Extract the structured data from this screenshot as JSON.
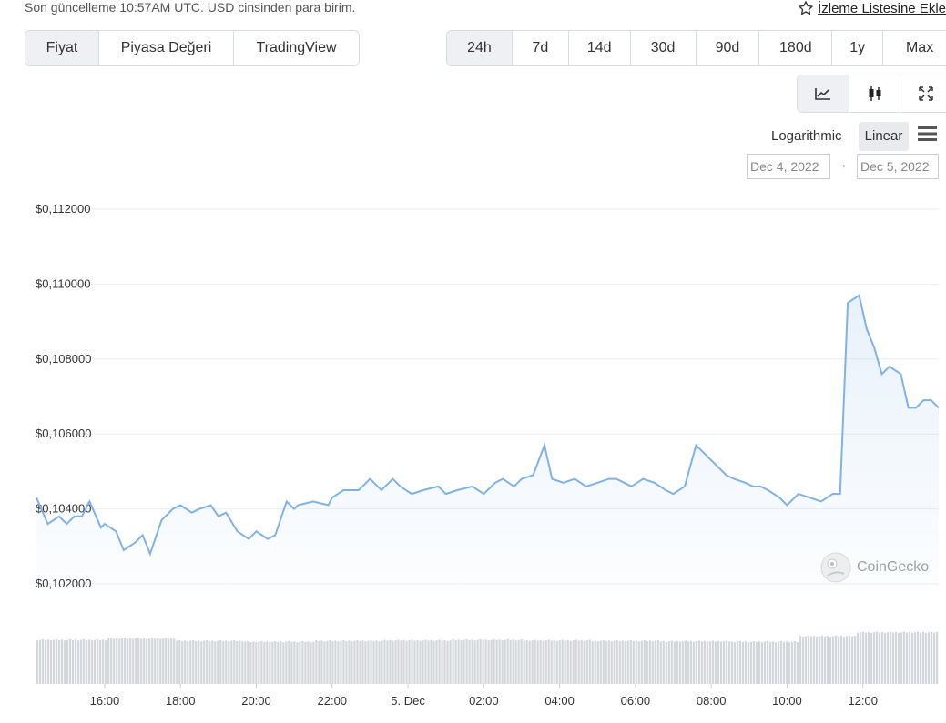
{
  "header": {
    "updated_text": "Son güncelleme 10:57AM UTC. USD cinsinden para birim.",
    "watchlist_label": "İzleme Listesine Ekle"
  },
  "view_tabs": [
    {
      "label": "Fiyat",
      "active": true
    },
    {
      "label": "Piyasa Değeri",
      "active": false
    },
    {
      "label": "TradingView",
      "active": false
    }
  ],
  "range_tabs": [
    {
      "label": "24h",
      "active": true
    },
    {
      "label": "7d",
      "active": false
    },
    {
      "label": "14d",
      "active": false
    },
    {
      "label": "30d",
      "active": false
    },
    {
      "label": "90d",
      "active": false
    },
    {
      "label": "180d",
      "active": false
    },
    {
      "label": "1y",
      "active": false
    },
    {
      "label": "Max",
      "active": false
    }
  ],
  "chart_types": [
    "line-chart-icon",
    "candlestick-icon",
    "expand-icon"
  ],
  "scale": {
    "log_label": "Logarithmic",
    "linear_label": "Linear",
    "selected": "Linear"
  },
  "date_range": {
    "from": "Dec 4, 2022",
    "to": "Dec 5, 2022"
  },
  "brand": "CoinGecko",
  "colors": {
    "line": "#7fb2e5",
    "volume": "#d3d6da",
    "active_tab": "#eef0f3"
  },
  "chart_data": {
    "type": "line",
    "x_ticks": [
      "16:00",
      "18:00",
      "20:00",
      "22:00",
      "5. Dec",
      "02:00",
      "04:00",
      "06:00",
      "08:00",
      "10:00",
      "12:00"
    ],
    "y_ticks": [
      "$0,102000",
      "$0,104000",
      "$0,106000",
      "$0,108000",
      "$0,110000",
      "$0,112000"
    ],
    "ylim": [
      0.1,
      0.112
    ],
    "x_range_hours": [
      14.2,
      38.0
    ],
    "series": [
      {
        "x": [
          14.2,
          14.5,
          14.8,
          15.0,
          15.2,
          15.4,
          15.6,
          15.9,
          16.0,
          16.3,
          16.5,
          16.8,
          17.0,
          17.2,
          17.5,
          17.8,
          18.0,
          18.3,
          18.5,
          18.8,
          19.0,
          19.2,
          19.5,
          19.8,
          20.0,
          20.3,
          20.5,
          20.8,
          21.0,
          21.1,
          21.5,
          21.9,
          22.0,
          22.3,
          22.7,
          23.0,
          23.3,
          23.6,
          23.8,
          24.1,
          24.4,
          24.8,
          25.0,
          25.3,
          25.7,
          26.0,
          26.3,
          26.5,
          26.8,
          27.0,
          27.3,
          27.6,
          27.8,
          28.1,
          28.4,
          28.7,
          29.0,
          29.3,
          29.5,
          29.7,
          29.9,
          30.2,
          30.5,
          30.8,
          31.0,
          31.3,
          31.6,
          31.8,
          32.1,
          32.4,
          32.6,
          32.9,
          33.1,
          33.3,
          33.5,
          33.8,
          34.0,
          34.3,
          34.6,
          34.9,
          35.2,
          35.4,
          35.6,
          35.9,
          36.1,
          36.3,
          36.5,
          36.6,
          36.7,
          37.0,
          37.2,
          37.4,
          37.6,
          37.8,
          38.0
        ],
        "y": [
          0.1043,
          0.1036,
          0.1038,
          0.1036,
          0.1038,
          0.1038,
          0.1042,
          0.1035,
          0.1036,
          0.1034,
          0.1029,
          0.1031,
          0.1033,
          0.1028,
          0.1037,
          0.104,
          0.1041,
          0.1039,
          0.104,
          0.1041,
          0.1038,
          0.1039,
          0.1034,
          0.1032,
          0.1034,
          0.1032,
          0.1033,
          0.1042,
          0.104,
          0.1041,
          0.1042,
          0.1041,
          0.1043,
          0.1045,
          0.1045,
          0.1048,
          0.1045,
          0.1048,
          0.1046,
          0.1044,
          0.1045,
          0.1046,
          0.1044,
          0.1045,
          0.1046,
          0.1044,
          0.1047,
          0.1048,
          0.1046,
          0.1048,
          0.1049,
          0.1057,
          0.1048,
          0.1047,
          0.1048,
          0.1046,
          0.1047,
          0.1048,
          0.1048,
          0.1047,
          0.1046,
          0.1048,
          0.1047,
          0.1045,
          0.1044,
          0.1046,
          0.1057,
          0.1055,
          0.1052,
          0.1049,
          0.1048,
          0.1047,
          0.1046,
          0.1046,
          0.1045,
          0.1043,
          0.1041,
          0.1044,
          0.1043,
          0.1042,
          0.1044,
          0.1044,
          0.1095,
          0.1097,
          0.1088,
          0.1083,
          0.1076,
          0.1077,
          0.1078,
          0.1076,
          0.1067,
          0.1067,
          0.1069,
          0.1069,
          0.1067
        ]
      }
    ],
    "volume": {
      "note": "relative bar heights",
      "levels": [
        0.92,
        0.95,
        0.9,
        0.88,
        0.9,
        0.91,
        0.92,
        0.91,
        0.9,
        0.89,
        0.88,
        1.0,
        1.05
      ]
    }
  }
}
